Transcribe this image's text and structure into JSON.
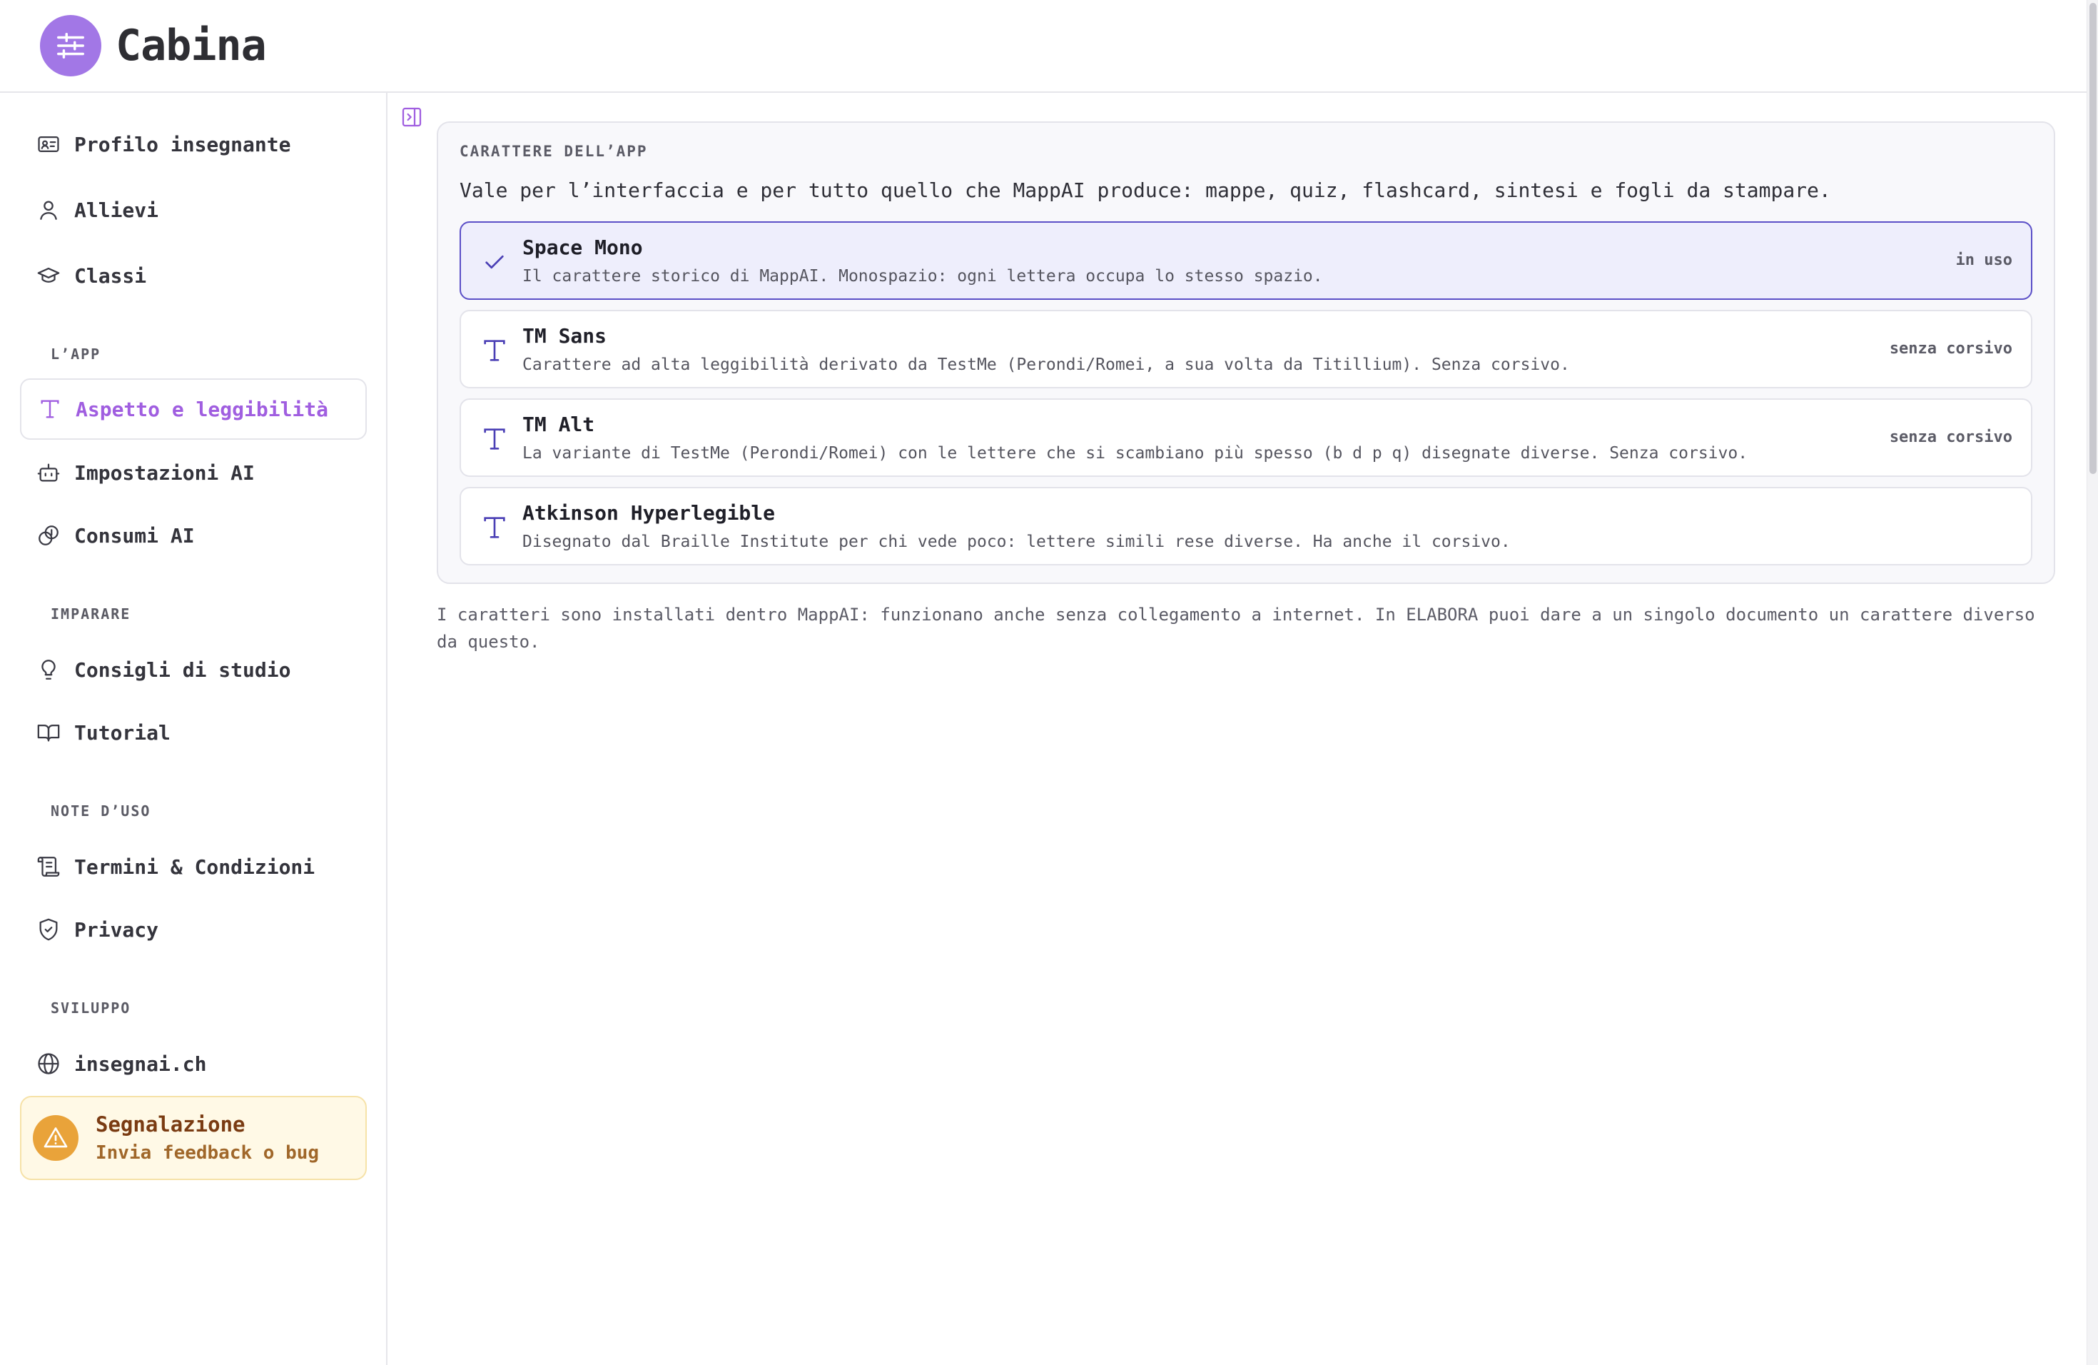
{
  "app": {
    "title": "Cabina",
    "accent": "#a277e6"
  },
  "sidebar": {
    "items": [
      {
        "label": "Profilo insegnante",
        "icon": "id-card-icon"
      },
      {
        "label": "Allievi",
        "icon": "user-icon"
      },
      {
        "label": "Classi",
        "icon": "graduation-cap-icon"
      }
    ],
    "sections": {
      "app": {
        "label": "L’APP",
        "items": [
          {
            "label": "Aspetto e leggibilità",
            "icon": "type-icon",
            "active": true
          },
          {
            "label": "Impostazioni AI",
            "icon": "robot-icon"
          },
          {
            "label": "Consumi AI",
            "icon": "coins-icon"
          }
        ]
      },
      "learn": {
        "label": "IMPARARE",
        "items": [
          {
            "label": "Consigli di studio",
            "icon": "lightbulb-icon"
          },
          {
            "label": "Tutorial",
            "icon": "book-icon"
          }
        ]
      },
      "notes": {
        "label": "NOTE D’USO",
        "items": [
          {
            "label": "Termini & Condizioni",
            "icon": "scroll-icon"
          },
          {
            "label": "Privacy",
            "icon": "shield-check-icon"
          }
        ]
      },
      "dev": {
        "label": "SVILUPPO",
        "items": [
          {
            "label": "insegnai.ch",
            "icon": "globe-icon"
          }
        ]
      }
    },
    "report": {
      "title": "Segnalazione",
      "subtitle": "Invia feedback o bug",
      "icon": "warning-icon"
    }
  },
  "main": {
    "panel_label": "CARATTERE DELL’APP",
    "panel_description": "Vale per l’interfaccia e per tutto quello che MappAI produce: mappe, quiz, flashcard, sintesi e fogli da stampare.",
    "fonts": [
      {
        "name": "Space Mono",
        "description": "Il carattere storico di MappAI. Monospazio: ogni lettera occupa lo stesso spazio.",
        "badge": "in uso",
        "selected": true,
        "icon": "check-icon"
      },
      {
        "name": "TM Sans",
        "description": "Carattere ad alta leggibilità derivato da TestMe (Perondi/Romei, a sua volta da Titillium). Senza corsivo.",
        "badge": "senza corsivo",
        "selected": false,
        "icon": "type-icon"
      },
      {
        "name": "TM Alt",
        "description": "La variante di TestMe (Perondi/Romei) con le lettere che si scambiano più spesso (b d p q) disegnate diverse. Senza corsivo.",
        "badge": "senza corsivo",
        "selected": false,
        "icon": "type-icon"
      },
      {
        "name": "Atkinson Hyperlegible",
        "description": "Disegnato dal Braille Institute per chi vede poco: lettere simili rese diverse. Ha anche il corsivo.",
        "badge": "",
        "selected": false,
        "icon": "type-icon"
      }
    ],
    "footnote": "I caratteri sono installati dentro MappAI: funzionano anche senza collegamento a internet. In ELABORA puoi dare a un singolo documento un carattere diverso da questo."
  }
}
